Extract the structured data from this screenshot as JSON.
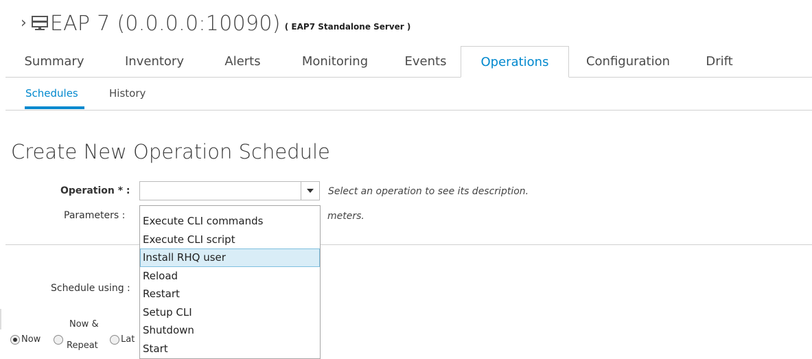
{
  "header": {
    "chevron": "›",
    "title": "EAP 7 (0.0.0.0:10090)",
    "subtitle": "( EAP7 Standalone Server )"
  },
  "tabs": [
    {
      "label": "Summary"
    },
    {
      "label": "Inventory"
    },
    {
      "label": "Alerts"
    },
    {
      "label": "Monitoring"
    },
    {
      "label": "Events"
    },
    {
      "label": "Operations",
      "active": true
    },
    {
      "label": "Configuration"
    },
    {
      "label": "Drift"
    }
  ],
  "subtabs": [
    {
      "label": "Schedules",
      "active": true
    },
    {
      "label": "History"
    }
  ],
  "page_title": "Create New Operation Schedule",
  "form": {
    "operation_label": "Operation * :",
    "operation_value": "",
    "operation_hint": "Select an operation to see its description.",
    "parameters_label": "Parameters :",
    "parameters_hint_visible": "meters.",
    "schedule_using_label": "Schedule using :"
  },
  "dropdown": {
    "items": [
      "Execute CLI commands",
      "Execute CLI script",
      "Install RHQ user",
      "Reload",
      "Restart",
      "Setup CLI",
      "Shutdown",
      "Start"
    ],
    "highlighted": "Install RHQ user"
  },
  "schedule_radios": {
    "now": "Now",
    "now_repeat_line1": "Now &",
    "now_repeat_line2": "Repeat",
    "later_partial": "Lat"
  },
  "colors": {
    "accent": "#0088ce",
    "highlight_bg": "#d9edf7"
  },
  "icons": {
    "server": "server-icon",
    "dropdown_arrow": "chevron-down-icon"
  }
}
